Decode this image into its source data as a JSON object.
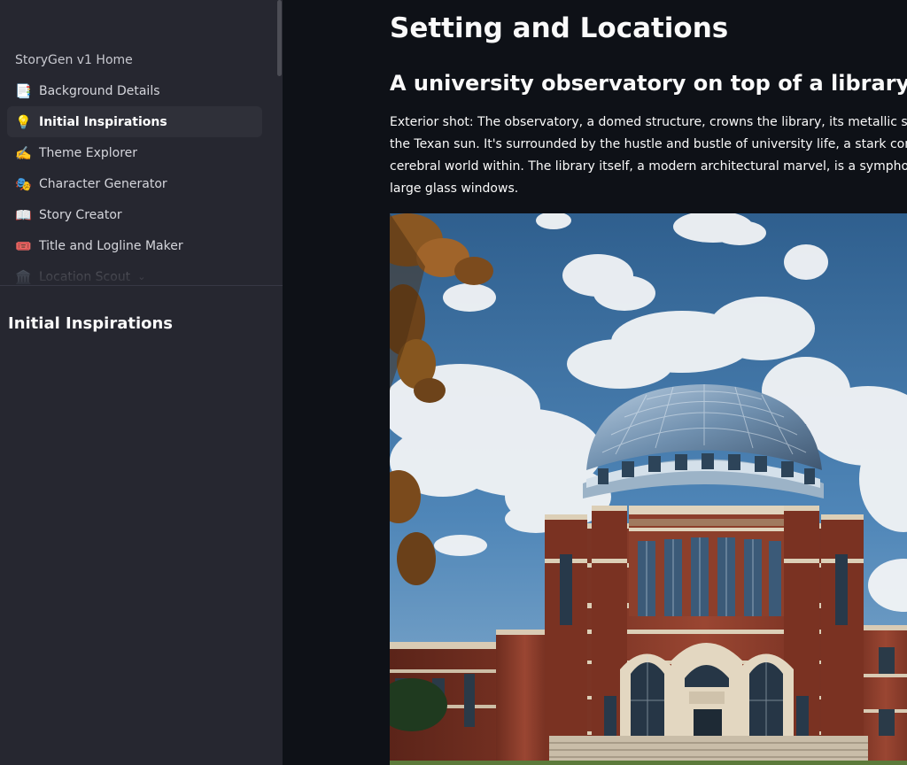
{
  "sidebar": {
    "home_label": "StoryGen v1 Home",
    "items": [
      {
        "label": "Background Details",
        "icon": "📑",
        "icon_name": "bookmark-tabs-icon"
      },
      {
        "label": "Initial Inspirations",
        "icon": "💡",
        "icon_name": "light-bulb-icon",
        "active": true
      },
      {
        "label": "Theme Explorer",
        "icon": "✍️",
        "icon_name": "writing-hand-icon"
      },
      {
        "label": "Character Generator",
        "icon": "🎭",
        "icon_name": "theater-masks-icon"
      },
      {
        "label": "Story Creator",
        "icon": "📖",
        "icon_name": "open-book-icon"
      },
      {
        "label": "Title and Logline Maker",
        "icon": "🎟️",
        "icon_name": "ticket-icon"
      },
      {
        "label": "Location Scout",
        "icon": "🏛️",
        "icon_name": "classical-building-icon"
      }
    ],
    "section_heading": "Initial Inspirations"
  },
  "main": {
    "page_title": "Setting and Locations",
    "section_title": "A university observatory on top of a library",
    "description_lines": [
      "Exterior shot: The observatory, a domed structure, crowns the library, its metallic surface gl",
      "the Texan sun. It's surrounded by the hustle and bustle of university life, a stark contrast to t",
      "cerebral world within. The library itself, a modern architectural marvel, is a symphony of red",
      "large glass windows."
    ]
  },
  "colors": {
    "sidebar_bg": "#262730",
    "main_bg": "#0e1117",
    "active_item_bg": "#2f3039",
    "text": "#fafafa"
  }
}
